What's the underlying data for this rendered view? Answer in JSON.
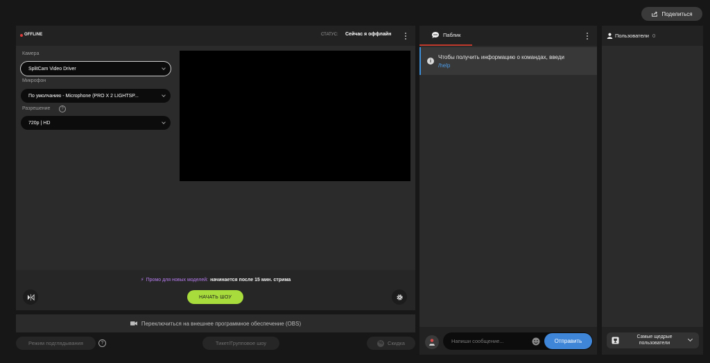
{
  "share": {
    "label": "Поделиться",
    "icon": "share-icon"
  },
  "broadcast": {
    "offline_label": "OFFLINE",
    "status_label": "СТАТУС:",
    "status_value": "Сейчас я оффлайн",
    "camera": {
      "label": "Камера",
      "value": "SplitCam Video Driver"
    },
    "microphone": {
      "label": "Микрофон",
      "value": "По умолчанию - Microphone (PRO X 2 LIGHTSP..."
    },
    "resolution": {
      "label": "Разрешение",
      "value": "720p | HD",
      "help": "?"
    },
    "promo": {
      "icon": "lightning-icon",
      "title": "Промо для новых моделей:",
      "text": "начинается после 15 мин. стрима"
    },
    "start_label": "НАЧАТЬ ШОУ",
    "flip_icon": "flip-video-icon",
    "settings_icon": "gear-icon"
  },
  "obs": {
    "label": "Переключиться на внешнее программное обеспечение (OBS)",
    "icon": "video-camera-icon"
  },
  "bottom": {
    "spy_label": "Режим подглядывания",
    "spy_help": "?",
    "ticket_label": "Тикет/Групповое шоу",
    "discount_label": "Скидка",
    "discount_icon": "%"
  },
  "chat": {
    "tab_label": "Паблик",
    "info_icon": "i",
    "info_text": "Чтобы получить информацию о командах, введи",
    "info_link": "/help",
    "message_placeholder": "Напиши сообщение...",
    "send_label": "Отправить"
  },
  "users": {
    "title": "Пользователи",
    "count": "0",
    "top_donors_label": "Самые щедрые пользователи"
  },
  "colors": {
    "accent_green": "#a7dc3c",
    "accent_blue": "#3f86d8",
    "promo_purple": "#b77cf0",
    "offline_red": "#e23b3b",
    "tab_underline": "#c0392b"
  }
}
